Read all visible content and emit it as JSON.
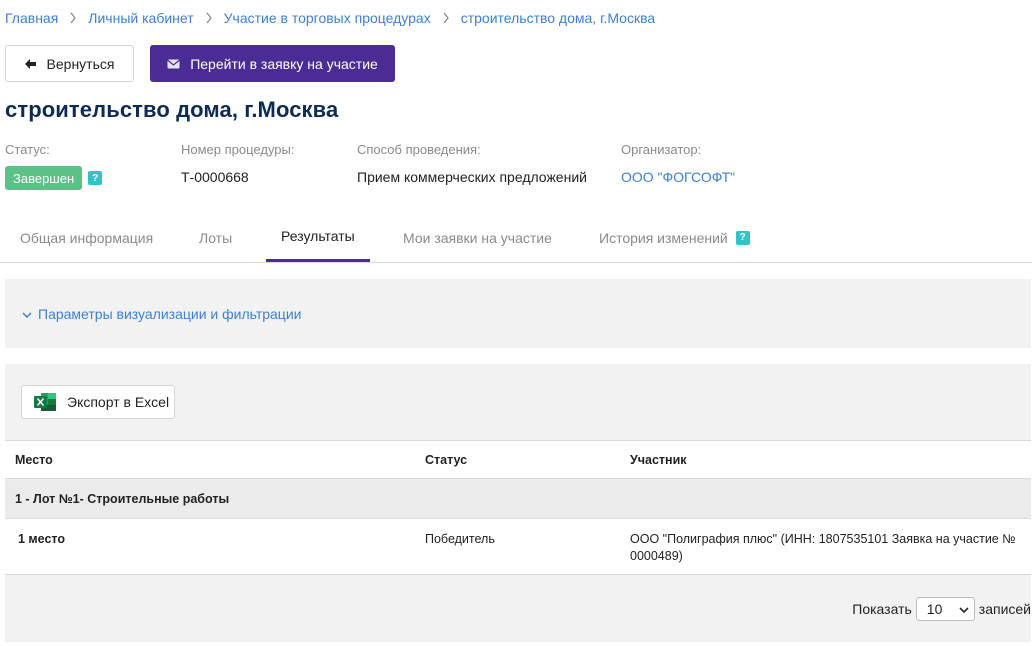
{
  "breadcrumb": [
    "Главная",
    "Личный кабинет",
    "Участие в торговых процедурах",
    "строительство дома, г.Москва"
  ],
  "actions": {
    "back_label": "Вернуться",
    "apply_label": "Перейти в заявку на участие"
  },
  "title": "строительство дома, г.Москва",
  "meta": {
    "status_label": "Статус:",
    "status_value": "Завершен",
    "number_label": "Номер процедуры:",
    "number_value": "Т-0000668",
    "method_label": "Способ проведения:",
    "method_value": "Прием коммерческих предложений",
    "organizer_label": "Организатор:",
    "organizer_value": "ООО \"ФОГСОФТ\""
  },
  "tabs": [
    "Общая информация",
    "Лоты",
    "Результаты",
    "Мои заявки на участие",
    "История изменений"
  ],
  "filter": {
    "label": "Параметры визуализации и фильтрации"
  },
  "export": {
    "label": "Экспорт в Excel"
  },
  "table": {
    "headers": [
      "Место",
      "Статус",
      "Участник"
    ],
    "group": "1 - Лот №1- Строительные работы",
    "rows": [
      {
        "place": "1 место",
        "status": "Победитель",
        "participant": "ООО \"Полиграфия плюс\" (ИНН: 1807535101 Заявка на участие № 0000489)"
      }
    ]
  },
  "pager": {
    "show_label": "Показать",
    "page_size": "10",
    "records_label": "записей"
  },
  "colors": {
    "accent": "#4b2c94",
    "link": "#3f7fd1",
    "success": "#5cc187",
    "help": "#32c3c8"
  }
}
